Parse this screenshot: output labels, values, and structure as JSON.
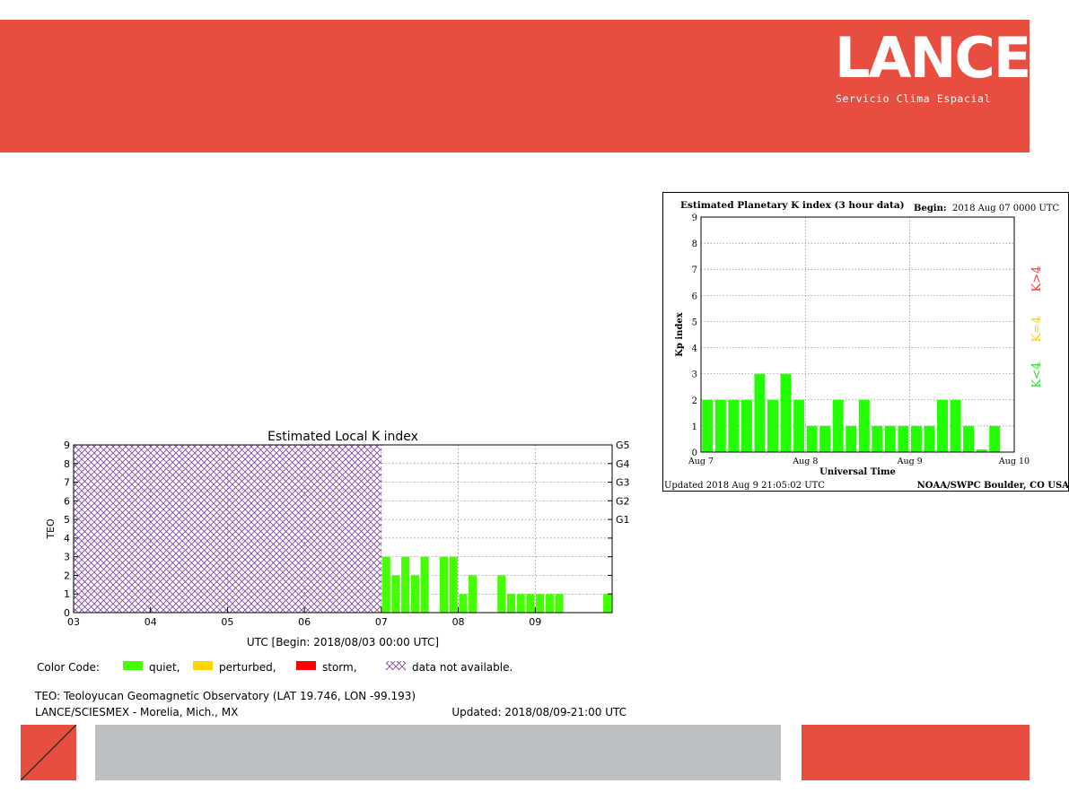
{
  "header": {
    "logo_text": "LANCE",
    "logo_tagline": "Servicio Clima Espacial",
    "brand_color": "#e84e3f"
  },
  "chart_data": [
    {
      "type": "bar",
      "title": "Estimated Local K index",
      "xlabel": "UTC [Begin: 2018/08/03 00:00 UTC]",
      "ylabel": "TEO",
      "ylim": [
        0,
        9
      ],
      "y_ticks": [
        "0",
        "1",
        "2",
        "3",
        "4",
        "5",
        "6",
        "7",
        "8",
        "9"
      ],
      "x_ticks": [
        "03",
        "04",
        "05",
        "06",
        "07",
        "08",
        "09"
      ],
      "right_ticks": [
        {
          "label": "G1",
          "value": 5
        },
        {
          "label": "G2",
          "value": 6
        },
        {
          "label": "G3",
          "value": 7
        },
        {
          "label": "G4",
          "value": 8
        },
        {
          "label": "G5",
          "value": 9
        }
      ],
      "x_range_days": [
        0,
        7
      ],
      "unavailable_range_days": [
        0,
        4
      ],
      "bin_hours": 3,
      "series": [
        {
          "values": [
            3,
            2,
            3,
            2,
            3,
            0,
            3,
            3,
            1,
            2,
            0,
            0,
            2,
            1,
            1,
            1,
            1,
            1,
            1,
            0,
            0,
            0,
            0,
            1
          ]
        }
      ],
      "series_start_day": 4,
      "grid": true,
      "legend": {
        "prefix": "Color Code:",
        "items": [
          {
            "label": "quiet,",
            "color": "#44ff00"
          },
          {
            "label": "perturbed,",
            "color": "#ffd700"
          },
          {
            "label": "storm,",
            "color": "#ff0000"
          },
          {
            "label": "data not available.",
            "color": "#7a3fa0",
            "pattern": "cross-hatch"
          }
        ]
      },
      "footer_lines": [
        "TEO: Teoloyucan Geomagnetic Observatory (LAT  19.746, LON -99.193)",
        "LANCE/SCIESMEX - Morelia, Mich., MX"
      ],
      "updated": "Updated: 2018/08/09-21:00 UTC"
    },
    {
      "type": "bar",
      "title": "Estimated Planetary K index (3 hour data)",
      "begin_label": "Begin:",
      "begin_value": "2018 Aug 07 0000 UTC",
      "xlabel": "Universal Time",
      "ylabel": "Kp index",
      "ylim": [
        0,
        9
      ],
      "y_ticks": [
        "0",
        "1",
        "2",
        "3",
        "4",
        "5",
        "6",
        "7",
        "8",
        "9"
      ],
      "x_ticks": [
        "Aug 7",
        "Aug 8",
        "Aug 9",
        "Aug 10"
      ],
      "x_range_days": [
        0,
        3
      ],
      "bin_hours": 3,
      "series": [
        {
          "values": [
            2,
            2,
            2,
            2,
            3,
            2,
            3,
            2,
            1,
            1,
            2,
            1,
            2,
            1,
            1,
            1,
            1,
            1,
            2,
            2,
            1,
            0.1,
            1,
            0
          ]
        }
      ],
      "grid": true,
      "side_labels": [
        {
          "label": "K>4",
          "color": "#ee3322"
        },
        {
          "label": "K=4",
          "color": "#ffcc00"
        },
        {
          "label": "K<4",
          "color": "#22dd22"
        }
      ],
      "updated": "Updated 2018 Aug  9 21:05:02 UTC",
      "source": "NOAA/SWPC Boulder, CO USA"
    }
  ]
}
